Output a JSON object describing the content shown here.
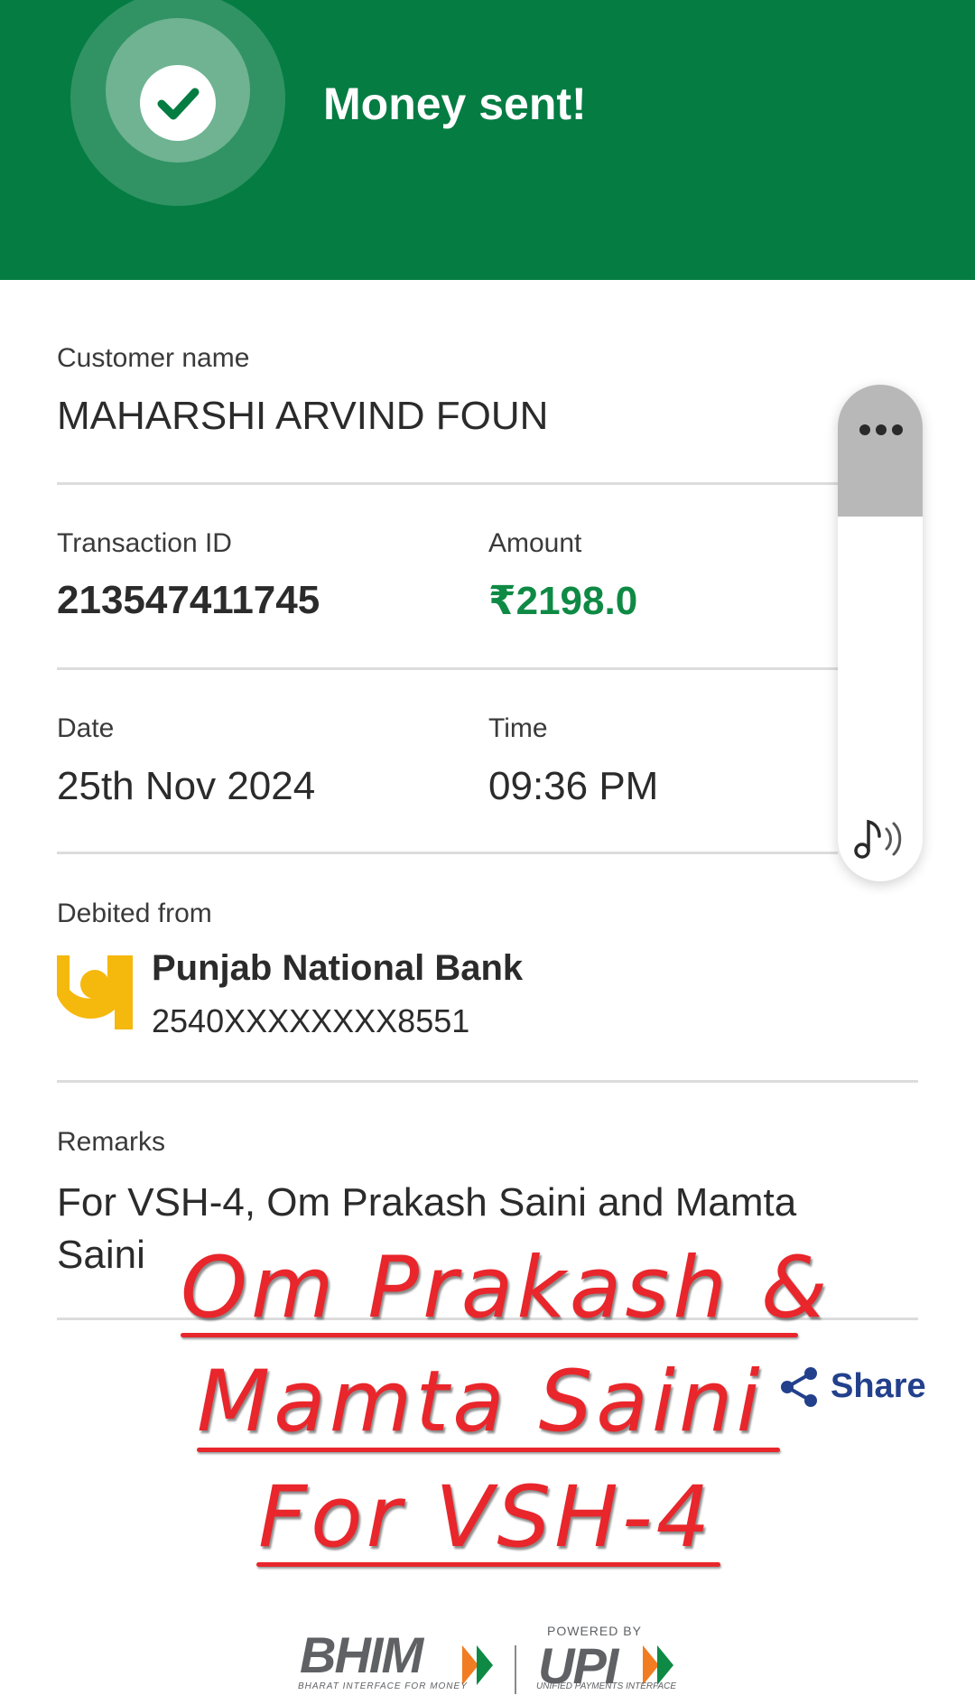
{
  "header": {
    "title": "Money sent!",
    "bg_color": "#047c42"
  },
  "customer": {
    "label": "Customer name",
    "value": "MAHARSHI ARVIND FOUN"
  },
  "transaction": {
    "id_label": "Transaction ID",
    "id_value": "213547411745",
    "amount_label": "Amount",
    "amount_value": "₹2198.0",
    "amount_color": "#0e8a45"
  },
  "datetime": {
    "date_label": "Date",
    "date_value": "25th Nov 2024",
    "time_label": "Time",
    "time_value": "09:36 PM"
  },
  "debited": {
    "label": "Debited from",
    "bank_name": "Punjab National Bank",
    "account": "2540XXXXXXXX8551"
  },
  "remarks": {
    "label": "Remarks",
    "value": "For VSH-4, Om Prakash Saini and Mamta Saini"
  },
  "share": {
    "label": "Share",
    "icon": "share-icon"
  },
  "side_panel": {
    "menu_icon": "more-dots-icon",
    "audio_icon": "sound-icon"
  },
  "handwritten": {
    "line1": "Om Prakash &",
    "line2": "Mamta Saini",
    "line3": "For VSH-4",
    "color": "#e8262b"
  },
  "footer": {
    "bhim": "BHIM",
    "bhim_tagline": "BHARAT INTERFACE FOR MONEY",
    "powered_by": "POWERED BY",
    "upi": "UPI",
    "upi_tagline": "UNIFIED PAYMENTS INTERFACE"
  }
}
